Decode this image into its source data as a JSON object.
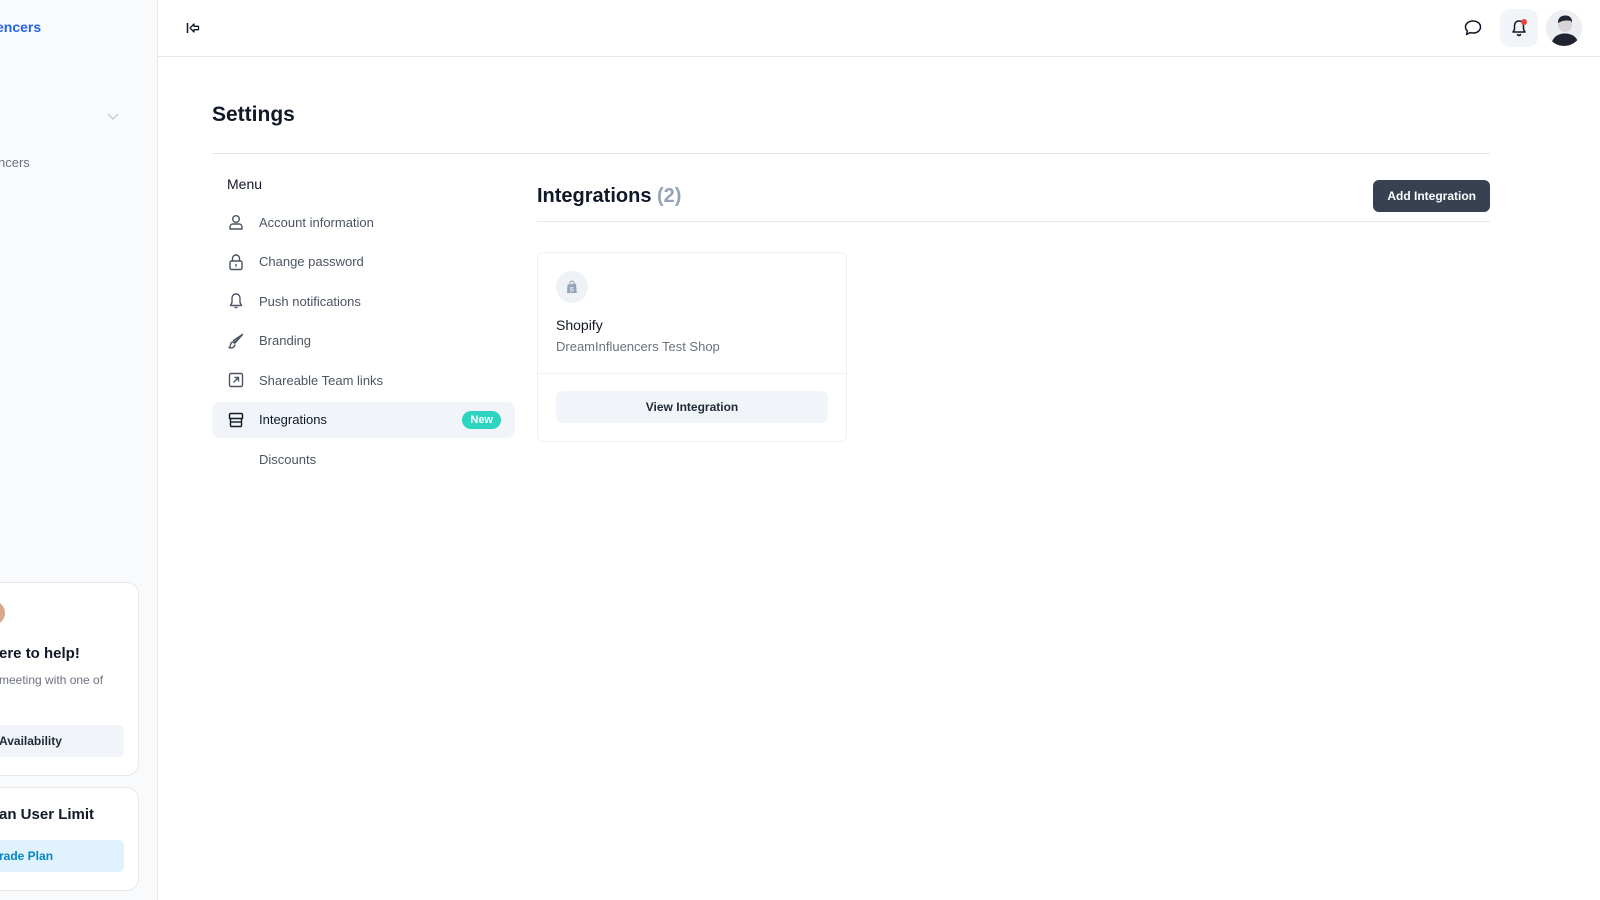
{
  "app_sidebar": {
    "brand": "encers",
    "nav_item_partial": "ncers",
    "help_card": {
      "title": "ere to help!",
      "text": "meeting with one of",
      "button_label": "Availability"
    },
    "limit_card": {
      "title": "an User Limit",
      "button_label": "rade Plan"
    }
  },
  "topbar": {
    "icons": [
      "collapse-sidebar-icon",
      "chat-icon",
      "bell-icon",
      "user-avatar"
    ],
    "notification_dot_color": "#ef4444"
  },
  "page": {
    "title": "Settings"
  },
  "settings_menu": {
    "heading": "Menu",
    "items": [
      {
        "label": "Account information",
        "icon": "user-icon"
      },
      {
        "label": "Change password",
        "icon": "lock-icon"
      },
      {
        "label": "Push notifications",
        "icon": "bell-icon"
      },
      {
        "label": "Branding",
        "icon": "brush-icon"
      },
      {
        "label": "Shareable Team links",
        "icon": "external-link-icon"
      },
      {
        "label": "Integrations",
        "icon": "store-icon",
        "active": true,
        "badge": "New"
      },
      {
        "label": "Discounts",
        "icon": ""
      }
    ]
  },
  "integrations": {
    "title": "Integrations",
    "count": "(2)",
    "add_button": "Add Integration",
    "cards": [
      {
        "name": "Shopify",
        "description": "DreamInfluencers Test Shop",
        "icon": "shopify-bag-icon",
        "button_label": "View Integration"
      }
    ]
  },
  "colors": {
    "accent": "#2563eb",
    "badge": "#2dd4bf",
    "primary_button": "#374151",
    "active_bg": "#f1f4f8"
  }
}
